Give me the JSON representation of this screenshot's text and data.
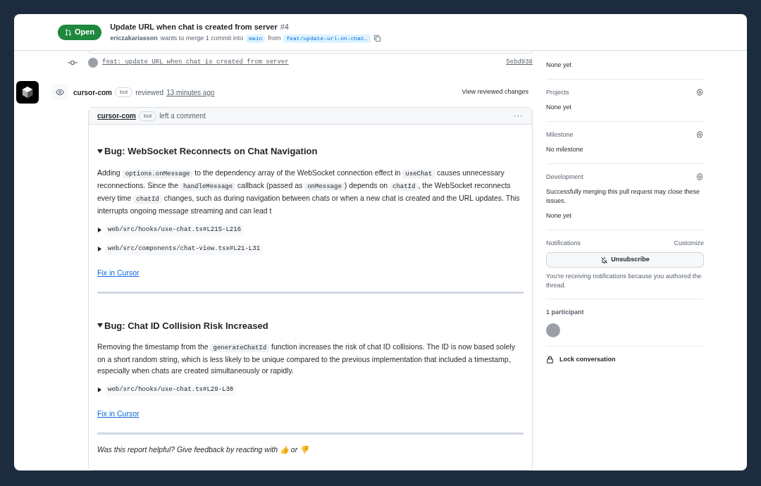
{
  "header": {
    "state": "Open",
    "title": "Update URL when chat is created from server",
    "number": "#4",
    "author": "ericzakariasson",
    "merge_text": "wants to merge 1 commit into",
    "base": "main",
    "from": "from",
    "head": "feat/update-url-on-chat…"
  },
  "commit": {
    "message": "feat: update URL when chat is created from server",
    "sha": "5ebd938"
  },
  "review": {
    "author": "cursor-com",
    "badge": "bot",
    "action": "reviewed",
    "time": "13 minutes ago",
    "link": "View reviewed changes"
  },
  "comment": {
    "author": "cursor-com",
    "badge": "bot",
    "action": "left a comment",
    "menu": "···",
    "bugs": [
      {
        "title": "Bug: WebSocket Reconnects on Chat Navigation",
        "expanded": true,
        "body": [
          {
            "kind": "text",
            "text": "Adding "
          },
          {
            "kind": "code",
            "text": "options.onMessage"
          },
          {
            "kind": "text",
            "text": " to the dependency array of the WebSocket connection effect in "
          },
          {
            "kind": "code",
            "text": "useChat"
          },
          {
            "kind": "text",
            "text": " causes unnecessary reconnections. Since the "
          },
          {
            "kind": "code",
            "text": "handleMessage"
          },
          {
            "kind": "text",
            "text": " callback (passed as "
          },
          {
            "kind": "code",
            "text": "onMessage"
          },
          {
            "kind": "text",
            "text": ") depends on "
          },
          {
            "kind": "code",
            "text": "chatId"
          },
          {
            "kind": "text",
            "text": ", the WebSocket reconnects every time "
          },
          {
            "kind": "code",
            "text": "chatId"
          },
          {
            "kind": "text",
            "text": " changes, such as during navigation between chats or when a new chat is created and the URL updates. This interrupts ongoing message streaming and can lead t"
          }
        ],
        "files": [
          {
            "path": "web/src/hooks/use-chat.ts#L215-L216",
            "expanded": false
          },
          {
            "path": "web/src/components/chat-view.tsx#L21-L31",
            "expanded": false
          }
        ],
        "fix": "Fix in Cursor"
      },
      {
        "title": "Bug: Chat ID Collision Risk Increased",
        "expanded": true,
        "body": [
          {
            "kind": "text",
            "text": "Removing the timestamp from the "
          },
          {
            "kind": "code",
            "text": "generateChatId"
          },
          {
            "kind": "text",
            "text": " function increases the risk of chat ID collisions. The ID is now based solely on a short random string, which is less likely to be unique compared to the previous implementation that included a timestamp, especially when chats are created simultaneously or rapidly."
          }
        ],
        "files": [
          {
            "path": "web/src/hooks/use-chat.ts#L29-L30",
            "expanded": false
          }
        ],
        "fix": "Fix in Cursor"
      }
    ],
    "feedback": "Was this report helpful? Give feedback by reacting with 👍 or 👎"
  },
  "sidebar": {
    "labels_value": "None yet",
    "sections": [
      {
        "title": "Projects",
        "value": "None yet"
      },
      {
        "title": "Milestone",
        "value": "No milestone"
      },
      {
        "title": "Development",
        "note": "Successfully merging this pull request may close these issues.",
        "value": "None yet"
      }
    ],
    "notifications": {
      "title": "Notifications",
      "customize": "Customize",
      "button": "Unsubscribe",
      "note": "You’re receiving notifications because you authored the thread."
    },
    "participants": {
      "title": "1 participant"
    },
    "lock": "Lock conversation"
  }
}
